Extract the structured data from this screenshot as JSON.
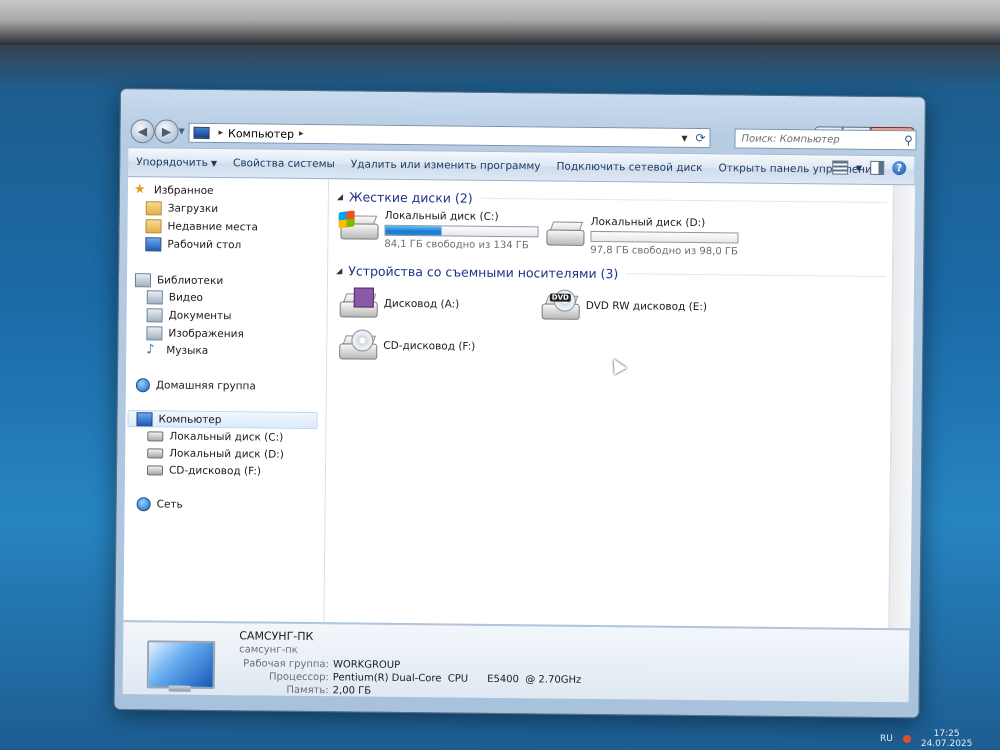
{
  "window": {
    "address": {
      "items": [
        "Компьютер"
      ]
    },
    "search_placeholder": "Поиск: Компьютер",
    "caption": {
      "minimize": "▬",
      "maximize": "□",
      "close": "✕"
    },
    "toolbar": {
      "organize": "Упорядочить",
      "items": [
        "Свойства системы",
        "Удалить или изменить программу",
        "Подключить сетевой диск",
        "Открыть панель управления"
      ]
    }
  },
  "sidebar": {
    "favorites": {
      "label": "Избранное",
      "items": [
        "Загрузки",
        "Недавние места",
        "Рабочий стол"
      ]
    },
    "libraries": {
      "label": "Библиотеки",
      "items": [
        "Видео",
        "Документы",
        "Изображения",
        "Музыка"
      ]
    },
    "homegroup": "Домашняя группа",
    "computer": {
      "label": "Компьютер",
      "items": [
        "Локальный диск (C:)",
        "Локальный диск (D:)",
        "CD-дисковод (F:)"
      ]
    },
    "network": "Сеть"
  },
  "groups": {
    "hard_drives": {
      "header": "Жесткие диски (2)",
      "drives": [
        {
          "name": "Локальный диск (C:)",
          "free": "84,1 ГБ свободно из 134 ГБ",
          "used_fraction": 0.37
        },
        {
          "name": "Локальный диск (D:)",
          "free": "97,8 ГБ свободно из 98,0 ГБ",
          "used_fraction": 0.002
        }
      ]
    },
    "removable": {
      "header": "Устройства со съемными носителями (3)",
      "drives": [
        "Дисковод (A:)",
        "DVD RW дисковод (E:)",
        "CD-дисковод (F:)"
      ],
      "dvd_badge": "DVD"
    }
  },
  "details": {
    "name": "САМСУНГ-ПК",
    "subname": "самсунг-пк",
    "rows": [
      {
        "k": "Рабочая группа:",
        "v": "WORKGROUP"
      },
      {
        "k": "Процессор:",
        "v": "Pentium(R) Dual-Core  CPU      E5400  @ 2.70GHz"
      },
      {
        "k": "Память:",
        "v": "2,00 ГБ"
      }
    ]
  },
  "taskbar": {
    "lang": "RU",
    "time": "17:25",
    "date": "24.07.2025"
  },
  "colors": {
    "accent": "#1e3287",
    "bar_fill": "#1b78d0"
  }
}
